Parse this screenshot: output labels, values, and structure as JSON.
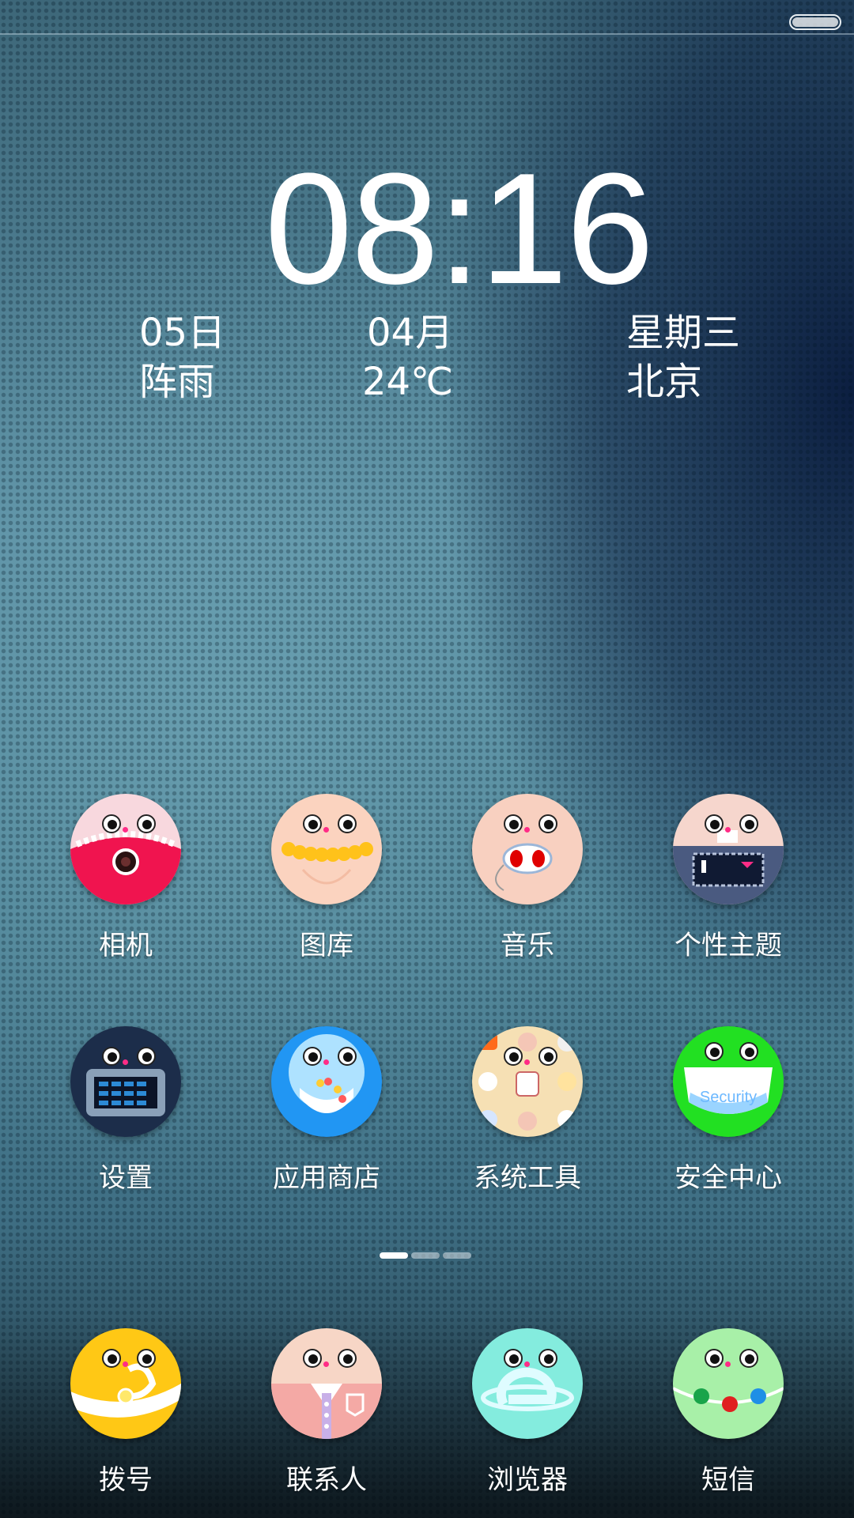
{
  "status_bar": {
    "battery_icon": "battery-icon"
  },
  "lock": {
    "time": "08:16",
    "day": "05日",
    "month": "04月",
    "weekday": "星期三",
    "weather": "阵雨",
    "temperature": "24℃",
    "city": "北京"
  },
  "apps": [
    {
      "label": "相机",
      "icon": "camera-icon"
    },
    {
      "label": "图库",
      "icon": "gallery-icon"
    },
    {
      "label": "音乐",
      "icon": "music-icon"
    },
    {
      "label": "个性主题",
      "icon": "theme-icon"
    },
    {
      "label": "设置",
      "icon": "settings-icon"
    },
    {
      "label": "应用商店",
      "icon": "app-store-icon"
    },
    {
      "label": "系统工具",
      "icon": "system-tools-icon"
    },
    {
      "label": "安全中心",
      "icon": "security-icon"
    }
  ],
  "dock": [
    {
      "label": "拨号",
      "icon": "phone-icon"
    },
    {
      "label": "联系人",
      "icon": "contacts-icon"
    },
    {
      "label": "浏览器",
      "icon": "browser-icon"
    },
    {
      "label": "短信",
      "icon": "messages-icon"
    }
  ],
  "security_icon_text": "Security",
  "page_indicator": {
    "pages": 3,
    "active_index": 0
  },
  "colors": {
    "camera": "#f0144f",
    "gallery": "#fbd3bf",
    "music": "#f8d0c0",
    "theme": "#4a5a80",
    "settings": "#1c2d4a",
    "app_store": "#2196f3",
    "system_tools": "#f6e0b4",
    "security": "#22e022",
    "phone": "#ffc815",
    "contacts": "#f4a9a5",
    "browser": "#84ecde",
    "messages": "#a8f0a8"
  }
}
